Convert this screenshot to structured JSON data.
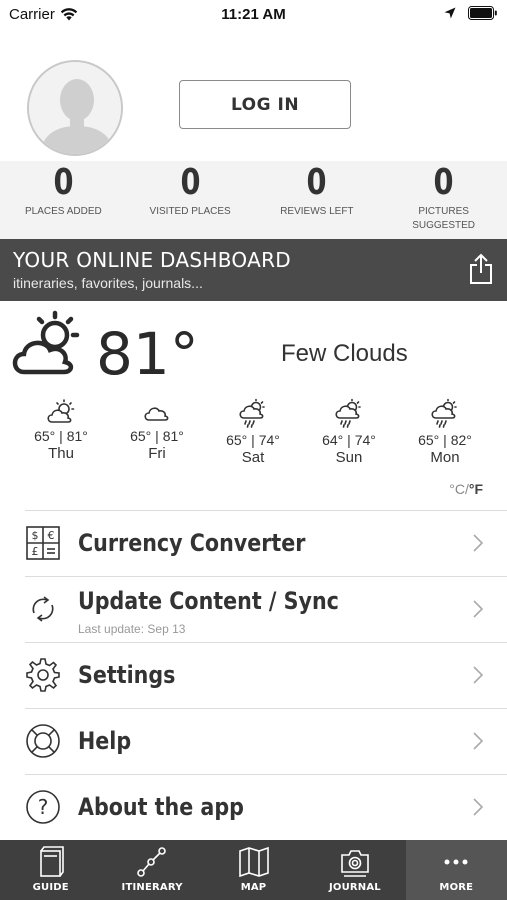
{
  "status_bar": {
    "carrier": "Carrier",
    "time": "11:21 AM"
  },
  "profile": {
    "login_label": "LOG IN"
  },
  "stats": [
    {
      "value": "0",
      "label": "PLACES ADDED"
    },
    {
      "value": "0",
      "label": "VISITED PLACES"
    },
    {
      "value": "0",
      "label": "REVIEWS LEFT"
    },
    {
      "value": "0",
      "label": "PICTURES SUGGESTED"
    }
  ],
  "dashboard": {
    "title": "YOUR ONLINE DASHBOARD",
    "subtitle": "itineraries, favorites, journals..."
  },
  "weather": {
    "current_temp": "81°",
    "condition": "Few Clouds",
    "current_icon": "partly-cloudy-icon",
    "forecast": [
      {
        "icon": "partly-cloudy-icon",
        "temps": "65° | 81°",
        "day": "Thu"
      },
      {
        "icon": "cloud-icon",
        "temps": "65° | 81°",
        "day": "Fri"
      },
      {
        "icon": "rain-icon",
        "temps": "65° | 74°",
        "day": "Sat"
      },
      {
        "icon": "rain-icon",
        "temps": "64° | 74°",
        "day": "Sun"
      },
      {
        "icon": "rain-icon",
        "temps": "65° | 82°",
        "day": "Mon"
      }
    ],
    "unit_c": "°C/",
    "unit_f": "°F"
  },
  "menu": [
    {
      "label": "Currency Converter",
      "icon": "currency-icon"
    },
    {
      "label": "Update Content / Sync",
      "sub": "Last update: Sep 13",
      "icon": "sync-icon"
    },
    {
      "label": "Settings",
      "icon": "gear-icon"
    },
    {
      "label": "Help",
      "icon": "lifebuoy-icon"
    },
    {
      "label": "About the app",
      "icon": "question-icon"
    }
  ],
  "tabbar": [
    {
      "label": "GUIDE",
      "icon": "book-icon"
    },
    {
      "label": "ITINERARY",
      "icon": "route-icon"
    },
    {
      "label": "MAP",
      "icon": "map-icon"
    },
    {
      "label": "JOURNAL",
      "icon": "camera-icon"
    },
    {
      "label": "MORE",
      "icon": "more-icon",
      "active": true
    }
  ]
}
